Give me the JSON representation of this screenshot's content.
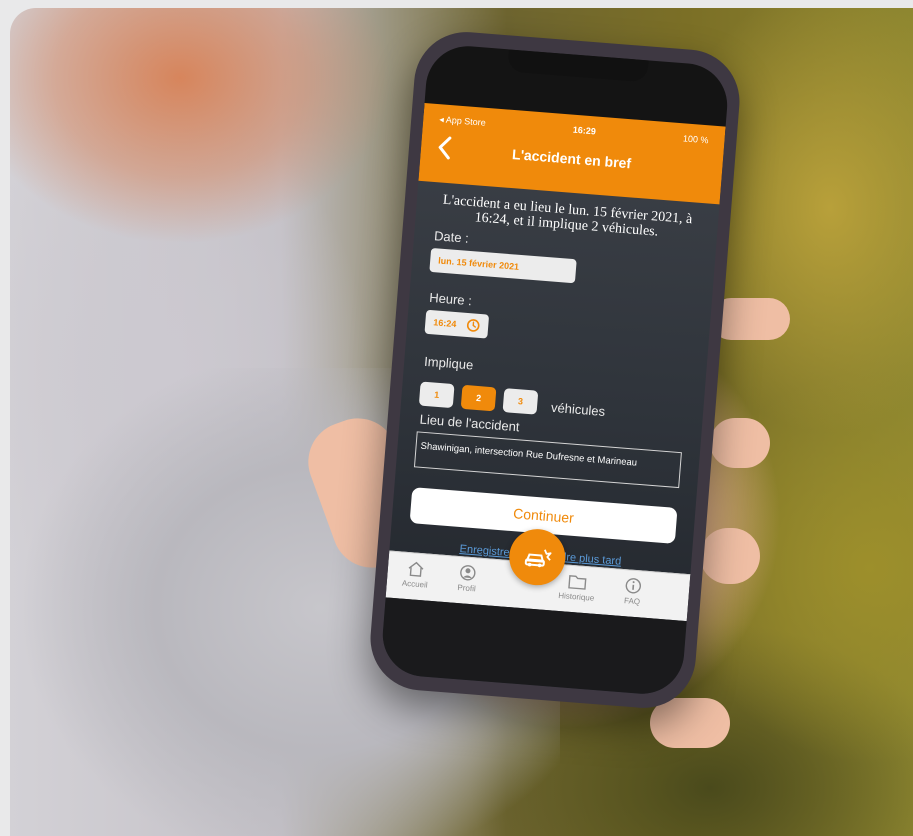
{
  "status_bar": {
    "carrier": "◂ App Store",
    "time": "16:29",
    "battery": "100 %"
  },
  "header": {
    "title": "L'accident en bref"
  },
  "summary_text": "L'accident a eu lieu le lun. 15 février 2021, à 16:24, et il implique 2 véhicules.",
  "date": {
    "label": "Date :",
    "value": "lun. 15 février 2021"
  },
  "time_field": {
    "label": "Heure :",
    "value": "16:24"
  },
  "vehicles": {
    "label": "Implique",
    "options": [
      "1",
      "2",
      "3"
    ],
    "selected": "2",
    "suffix": "véhicules"
  },
  "location": {
    "label": "Lieu de l'accident",
    "value": "Shawinigan, intersection Rue Dufresne et Marineau"
  },
  "actions": {
    "continue_label": "Continuer",
    "save_later_label": "Enregistrer et reprendre plus tard"
  },
  "tabbar": {
    "items": [
      {
        "label": "Accueil",
        "icon": "home-icon"
      },
      {
        "label": "Profil",
        "icon": "profile-icon"
      },
      {
        "label": "",
        "icon": "car-accident-icon"
      },
      {
        "label": "Historique",
        "icon": "folder-icon"
      },
      {
        "label": "FAQ",
        "icon": "info-icon"
      }
    ]
  },
  "colors": {
    "accent": "#f08a0b",
    "link": "#5b9bd8"
  }
}
